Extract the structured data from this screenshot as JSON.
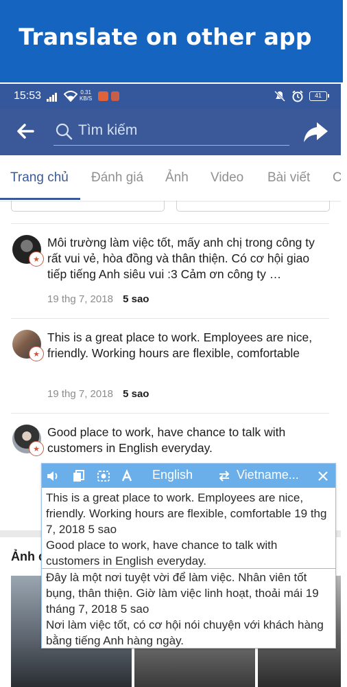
{
  "banner": {
    "title": "Translate on other app"
  },
  "statusbar": {
    "time": "15:53",
    "net_speed_value": "0.31",
    "net_speed_unit": "KB/S",
    "battery": "41"
  },
  "appbar": {
    "search_placeholder": "Tìm kiếm"
  },
  "tabs": [
    {
      "label": "Trang chủ",
      "active": true
    },
    {
      "label": "Đánh giá"
    },
    {
      "label": "Ảnh"
    },
    {
      "label": "Video"
    },
    {
      "label": "Bài viết"
    },
    {
      "label": "C"
    }
  ],
  "reviews": [
    {
      "text": "Môi trường làm việc tốt, mấy anh chị trong công ty rất vui vẻ, hòa đồng và thân thiện. Có cơ hội giao tiếp tiếng Anh siêu vui :3 Cảm ơn công ty …",
      "date": "19 thg 7, 2018",
      "rating": "5 sao"
    },
    {
      "text": "This is a great place to work. Employees are nice, friendly. Working hours are flexible, comfortable",
      "date": "19 thg 7, 2018",
      "rating": "5 sao"
    },
    {
      "text": "Good place to work, have chance to talk with customers in English everyday."
    }
  ],
  "photos": {
    "heading": "Ảnh c"
  },
  "translate_popup": {
    "source_lang": "English",
    "target_lang": "Vietname...",
    "source_text": "This is a great place to work. Employees are nice, friendly. Working hours are flexible, comfortable 19 thg 7, 2018 5 sao\nGood place to work, have chance to talk with customers in English everyday.",
    "translated_text": "Đây là một nơi tuyệt vời để làm việc. Nhân viên tốt bụng, thân thiện. Giờ làm việc linh hoạt, thoải mái 19 tháng 7, 2018 5 sao\nNơi làm việc tốt, có cơ hội nói chuyện với khách hàng bằng tiếng Anh hàng ngày."
  },
  "colors": {
    "banner": "#1565c0",
    "appbar": "#3b5998",
    "statusbar": "#35579c",
    "popup_bar": "#6aaeea"
  }
}
